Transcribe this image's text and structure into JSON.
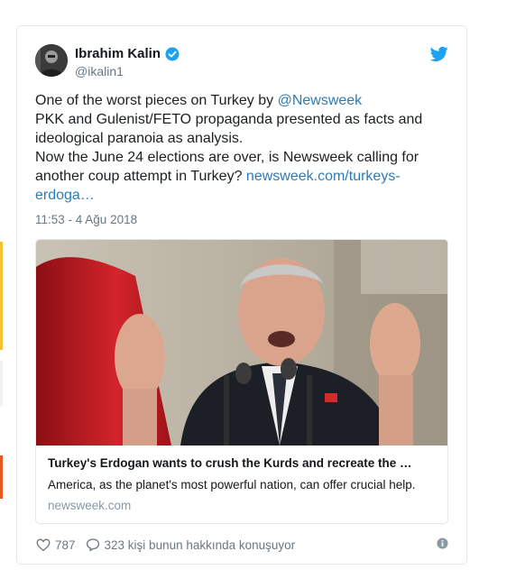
{
  "tweet": {
    "author_name": "Ibrahim Kalin",
    "author_handle": "@ikalin1",
    "text_line1_pre": "One of the worst pieces on Turkey by ",
    "mention": "@Newsweek",
    "text_line2": "PKK and Gulenist/FETO propaganda presented as facts and",
    "text_line3": "ideological paranoia as analysis.",
    "text_line4": "Now the June 24 elections are over, is Newsweek calling for",
    "text_line5_pre": "another coup attempt in Turkey? ",
    "link_part1": "newsweek.com/turkeys-",
    "link_part2": "erdoga…",
    "timestamp": "11:53 - 4 Ağu 2018"
  },
  "link_card": {
    "title": "Turkey's Erdogan wants to crush the Kurds and recreate the …",
    "description": "America, as the planet's most powerful nation, can offer crucial help.",
    "domain": "newsweek.com"
  },
  "actions": {
    "likes": "787",
    "replies_text": "323 kişi bunun hakkında konuşuyor"
  },
  "colors": {
    "link": "#2b7bb9",
    "twitter_blue": "#1da1f2",
    "muted": "#697882"
  }
}
